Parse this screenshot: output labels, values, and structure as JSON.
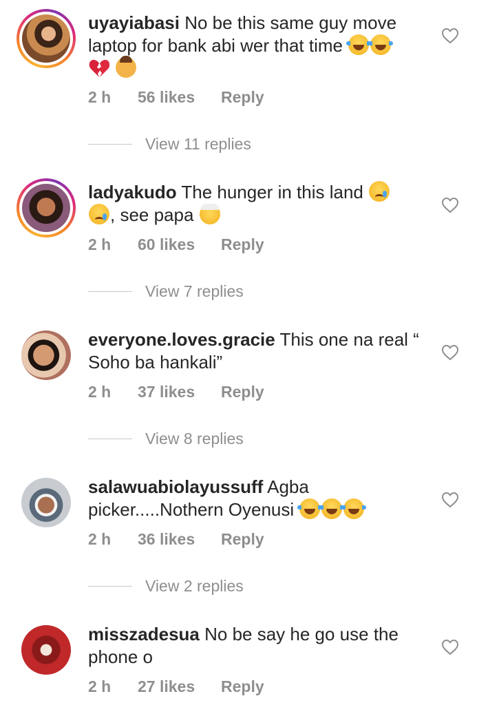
{
  "comments": [
    {
      "username": "uyayiabasi",
      "text_line1": "No be this same guy move",
      "text_line2": "laptop for bank abi wer that time",
      "time": "2 h",
      "likes": "56 likes",
      "reply": "Reply",
      "view_replies": "View 11 replies",
      "avatar_style": "story"
    },
    {
      "username": "ladyakudo",
      "text_line1": "The hunger in this land",
      "text_line2": ", see papa",
      "time": "2 h",
      "likes": "60 likes",
      "reply": "Reply",
      "view_replies": "View 7 replies",
      "avatar_style": "story"
    },
    {
      "username": "everyone.loves.gracie",
      "text_line1": "This one na real “",
      "text_line2": "Soho ba hankali”",
      "time": "2 h",
      "likes": "37 likes",
      "reply": "Reply",
      "view_replies": "View 8 replies",
      "avatar_style": "plain"
    },
    {
      "username": "salawuabiolayussuff",
      "text_line1": "Agba",
      "text_line2": "picker.....Nothern Oyenusi",
      "time": "2 h",
      "likes": "36 likes",
      "reply": "Reply",
      "view_replies": "View 2 replies",
      "avatar_style": "plain"
    },
    {
      "username": "misszadesua",
      "text_line1": "No be say he go use the",
      "text_line2": "phone o",
      "time": "2 h",
      "likes": "27 likes",
      "reply": "Reply",
      "avatar_style": "plain"
    }
  ],
  "icons": {
    "like": "heart-outline-icon",
    "emoji_laugh": "face-with-tears-of-joy-icon",
    "emoji_cry": "crying-face-icon",
    "emoji_old": "older-person-icon",
    "emoji_broken": "broken-heart-icon",
    "emoji_facepalm": "person-facepalming-icon"
  },
  "colors": {
    "text": "#262626",
    "muted": "#8e8e8e",
    "divider": "#c7c7c7"
  }
}
